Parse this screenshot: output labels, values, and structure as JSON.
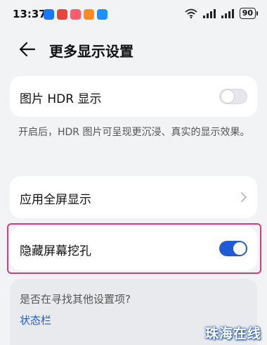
{
  "status_bar": {
    "time": "13:37",
    "battery": "90",
    "app_icons": [
      {
        "name": "alipay-icon",
        "color": "#1677ff"
      },
      {
        "name": "app-icon-red",
        "color": "#e8443a"
      },
      {
        "name": "app-icon-pink",
        "color": "#ff5b6e"
      },
      {
        "name": "app-icon-orange",
        "color": "#ff8a1f"
      },
      {
        "name": "app-icon-blue",
        "color": "#1e90ff"
      }
    ]
  },
  "header": {
    "title": "更多显示设置"
  },
  "hdr": {
    "label": "图片 HDR 显示",
    "toggle_on": false,
    "description": "开启后，HDR 图片可呈现更沉浸、真实的显示效果。"
  },
  "fullscreen": {
    "label": "应用全屏显示"
  },
  "hide_notch": {
    "label": "隐藏屏幕挖孔",
    "toggle_on": true
  },
  "suggestion": {
    "question": "是否在寻找其他设置项?",
    "link": "状态栏"
  },
  "watermark": "珠海在线",
  "colors": {
    "accent": "#1f5bd6",
    "highlight": "#d63a7c",
    "background": "#f1f3f5"
  }
}
